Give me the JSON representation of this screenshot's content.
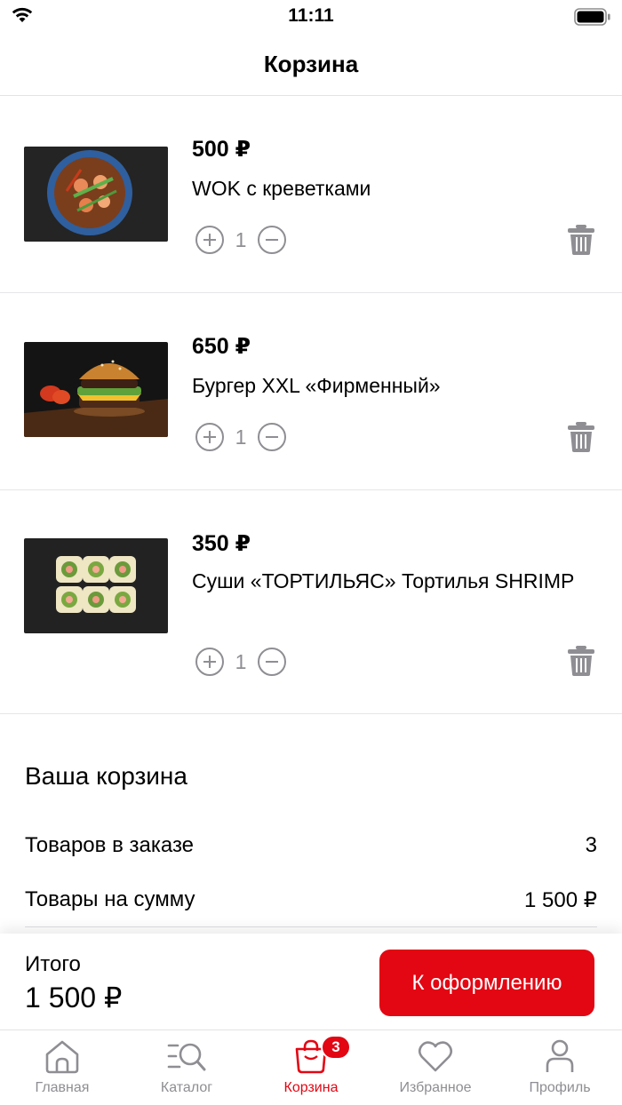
{
  "status_bar": {
    "time": "11:11"
  },
  "header": {
    "title": "Корзина"
  },
  "cart_items": [
    {
      "price": "500 ₽",
      "name": "WOK с креветками",
      "quantity": "1"
    },
    {
      "price": "650 ₽",
      "name": "Бургер XXL «Фирменный»",
      "quantity": "1"
    },
    {
      "price": "350 ₽",
      "name": "Суши «ТОРТИЛЬЯС» Тортилья SHRIMP",
      "quantity": "1"
    }
  ],
  "summary": {
    "title": "Ваша корзина",
    "items_label": "Товаров в заказе",
    "items_value": "3",
    "sum_label": "Товары на сумму",
    "sum_value": "1 500 ₽"
  },
  "checkout": {
    "total_label": "Итого",
    "total_value": "1 500 ₽",
    "button_label": "К оформлению"
  },
  "tab_bar": {
    "tabs": [
      {
        "label": "Главная",
        "icon": "home-icon"
      },
      {
        "label": "Каталог",
        "icon": "catalog-search-icon"
      },
      {
        "label": "Корзина",
        "icon": "bag-icon"
      },
      {
        "label": "Избранное",
        "icon": "heart-icon"
      },
      {
        "label": "Профиль",
        "icon": "person-icon"
      }
    ],
    "active_index": 2,
    "cart_badge": "3"
  },
  "colors": {
    "accent": "#e30613",
    "muted": "#8e8e93"
  }
}
